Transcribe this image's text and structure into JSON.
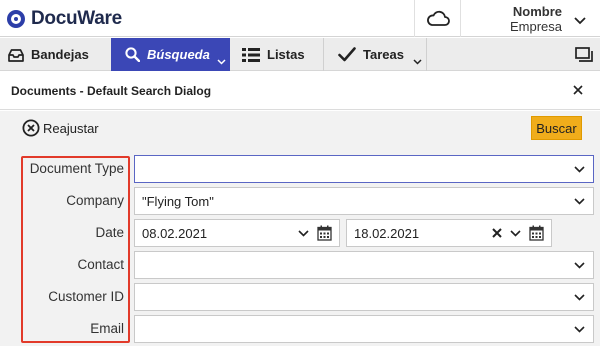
{
  "app": {
    "logo_text": "DocuWare",
    "user_name": "Nombre",
    "user_company": "Empresa"
  },
  "nav": {
    "items": [
      {
        "label": "Bandejas",
        "icon": "tray-icon",
        "active": false
      },
      {
        "label": "Búsqueda",
        "icon": "search-icon",
        "active": true
      },
      {
        "label": "Listas",
        "icon": "list-icon",
        "active": false
      },
      {
        "label": "Tareas",
        "icon": "checkmark-icon",
        "active": false
      }
    ]
  },
  "dialog": {
    "title": "Documents - Default Search Dialog"
  },
  "toolbar": {
    "reset_label": "Reajustar",
    "search_label": "Buscar"
  },
  "form": {
    "document_type": {
      "label": "Document Type",
      "value": ""
    },
    "company": {
      "label": "Company",
      "value": "\"Flying Tom\""
    },
    "date": {
      "label": "Date",
      "from": "08.02.2021",
      "to": "18.02.2021"
    },
    "contact": {
      "label": "Contact",
      "value": ""
    },
    "customer_id": {
      "label": "Customer ID",
      "value": ""
    },
    "email": {
      "label": "Email",
      "value": ""
    }
  },
  "colors": {
    "accent": "#3b47b6",
    "search_button": "#f0ad1b",
    "highlight": "#e23a2a"
  }
}
